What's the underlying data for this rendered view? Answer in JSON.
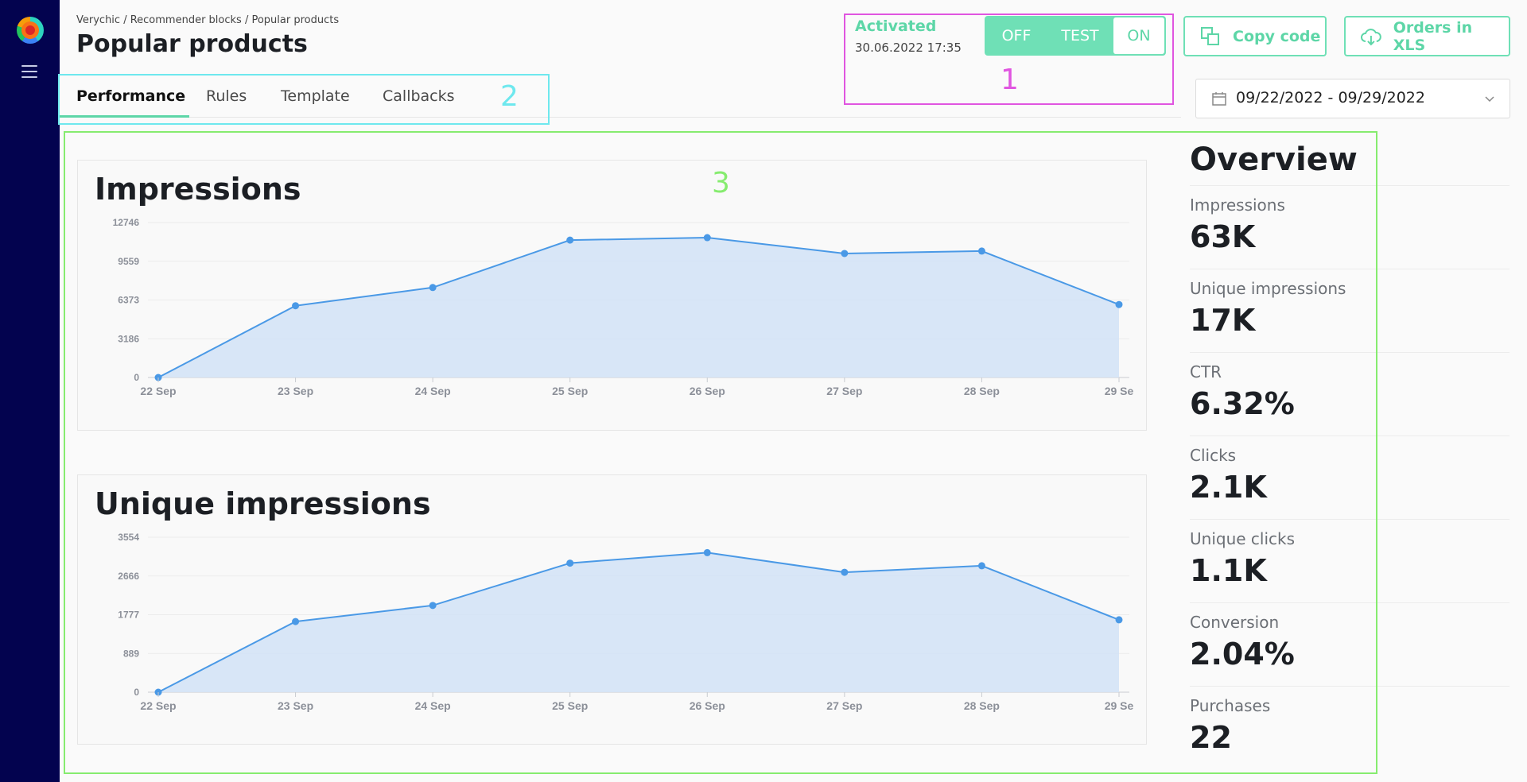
{
  "breadcrumb": "Verychic / Recommender blocks / Popular products",
  "page_title": "Popular products",
  "tabs": [
    {
      "label": "Performance",
      "active": true
    },
    {
      "label": "Rules",
      "active": false
    },
    {
      "label": "Template",
      "active": false
    },
    {
      "label": "Callbacks",
      "active": false
    }
  ],
  "status": {
    "label": "Activated",
    "date": "30.06.2022 17:35",
    "toggle_options": [
      "OFF",
      "TEST",
      "ON"
    ],
    "selected": "ON"
  },
  "buttons": {
    "copy_code": "Copy code",
    "orders_xls": "Orders in XLS"
  },
  "date_range": "09/22/2022 - 09/29/2022",
  "annotations": {
    "one": "1",
    "two": "2",
    "three": "3"
  },
  "colors": {
    "accent": "#5dd6a7",
    "sidebar": "#03034f",
    "line": "#4a99e6",
    "area": "#d4e3f6",
    "annot_1": "#e055e0",
    "annot_2": "#6ee8ee",
    "annot_3": "#86ec6f"
  },
  "overview": {
    "title": "Overview",
    "items": [
      {
        "label": "Impressions",
        "value": "63K"
      },
      {
        "label": "Unique impressions",
        "value": "17K"
      },
      {
        "label": "CTR",
        "value": "6.32%"
      },
      {
        "label": "Clicks",
        "value": "2.1K"
      },
      {
        "label": "Unique clicks",
        "value": "1.1K"
      },
      {
        "label": "Conversion",
        "value": "2.04%"
      },
      {
        "label": "Purchases",
        "value": "22"
      }
    ]
  },
  "chart_data": [
    {
      "type": "area",
      "title": "Impressions",
      "categories": [
        "22 Sep",
        "23 Sep",
        "24 Sep",
        "25 Sep",
        "26 Sep",
        "27 Sep",
        "28 Sep",
        "29 Se"
      ],
      "values": [
        0,
        5900,
        7400,
        11300,
        11500,
        10200,
        10400,
        6000
      ],
      "yticks": [
        "12746",
        "9559",
        "6373",
        "3186",
        "0"
      ],
      "ylim": [
        0,
        12746
      ],
      "grid": true
    },
    {
      "type": "area",
      "title": "Unique impressions",
      "categories": [
        "22 Sep",
        "23 Sep",
        "24 Sep",
        "25 Sep",
        "26 Sep",
        "27 Sep",
        "28 Sep",
        "29 Se"
      ],
      "values": [
        0,
        1620,
        1990,
        2960,
        3200,
        2750,
        2900,
        1660
      ],
      "yticks": [
        "3554",
        "2666",
        "1777",
        "889",
        "0"
      ],
      "ylim": [
        0,
        3554
      ],
      "grid": true
    }
  ]
}
